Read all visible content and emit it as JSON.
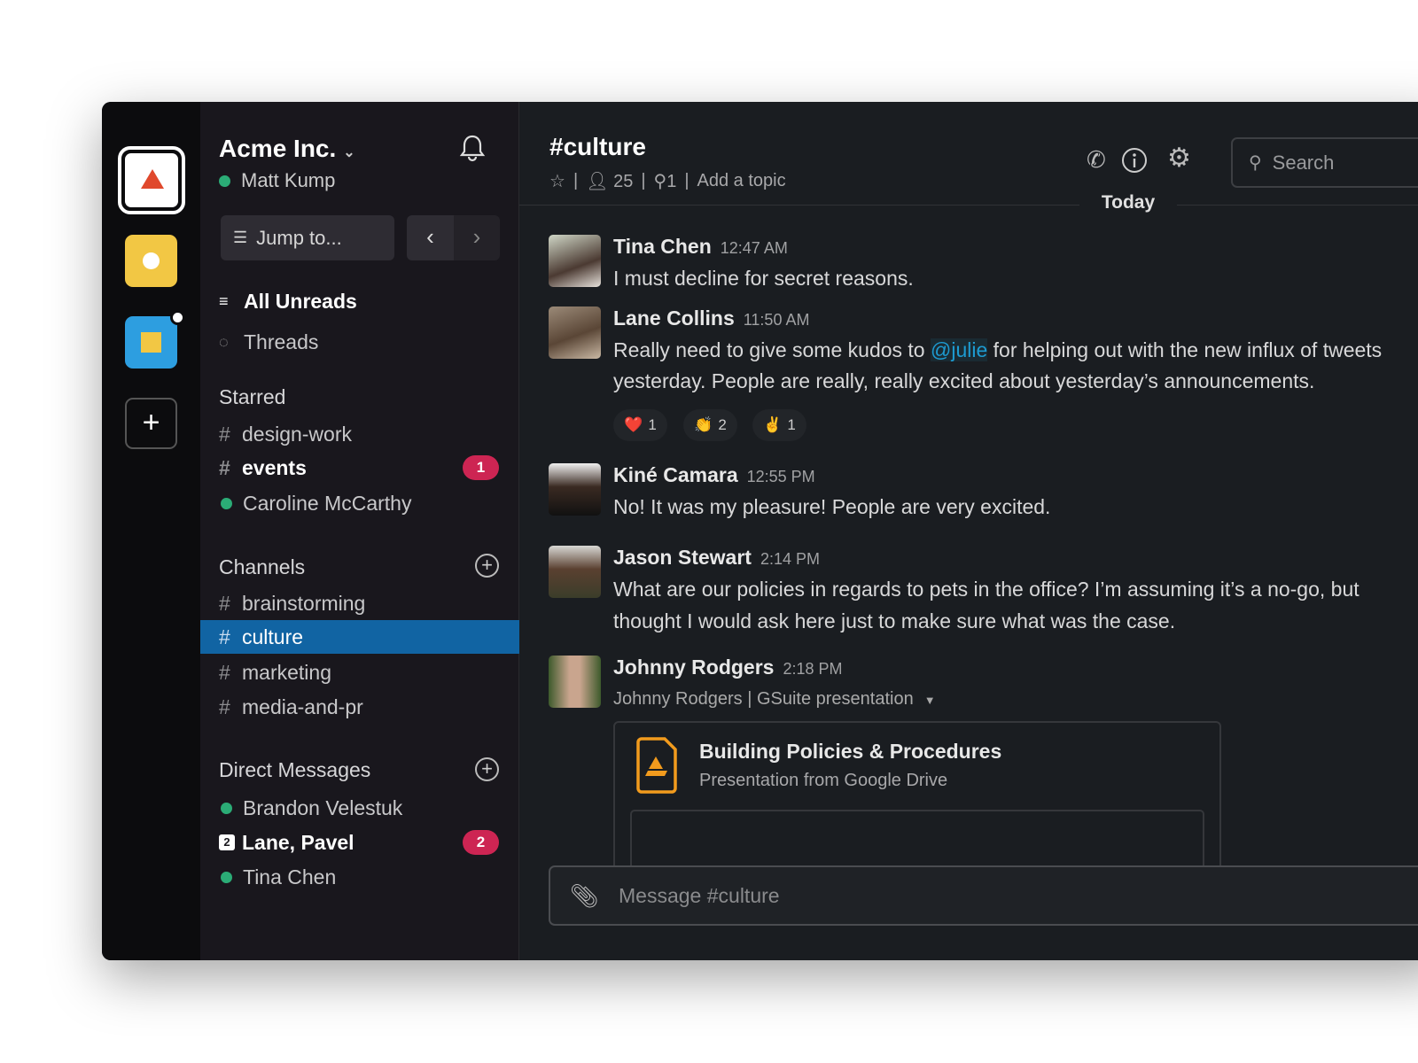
{
  "window": {
    "traffic_lights": [
      "#ed6a5e",
      "#f5bf4f",
      "#61c554"
    ]
  },
  "rail": {
    "workspaces": [
      {
        "color": "#ffffff",
        "accent": "#e0482c",
        "selected": true
      },
      {
        "color": "#f2c744",
        "accent": "#ffffff"
      },
      {
        "color": "#2d9ee0",
        "accent": "#f2c744",
        "unread_dot": true
      }
    ],
    "add_label": "+"
  },
  "sidebar": {
    "workspace_name": "Acme Inc.",
    "user": "Matt Kump",
    "jump_to": "Jump to...",
    "all_unreads": "All Unreads",
    "threads": "Threads",
    "starred_title": "Starred",
    "starred": [
      {
        "type": "channel",
        "label": "design-work"
      },
      {
        "type": "channel",
        "label": "events",
        "bold": true,
        "badge": "1"
      },
      {
        "type": "dm",
        "label": "Caroline McCarthy"
      }
    ],
    "channels_title": "Channels",
    "channels": [
      {
        "label": "brainstorming"
      },
      {
        "label": "culture",
        "selected": true
      },
      {
        "label": "marketing"
      },
      {
        "label": "media-and-pr"
      }
    ],
    "dms_title": "Direct Messages",
    "dms": [
      {
        "label": "Brandon Velestuk"
      },
      {
        "label": "Lane, Pavel",
        "bold": true,
        "badge": "2",
        "group_count": "2"
      },
      {
        "label": "Tina Chen"
      }
    ],
    "accent": "#1164a3",
    "badge_color": "#cd2553",
    "presence_color": "#2bac76"
  },
  "header": {
    "channel": "#culture",
    "members": "25",
    "pins": "1",
    "add_topic": "Add a topic",
    "search_placeholder": "Search",
    "divider": "|"
  },
  "day_divider": "Today",
  "messages": [
    {
      "name": "Tina Chen",
      "time": "12:47 AM",
      "lines": [
        "I must decline for secret reasons."
      ]
    },
    {
      "name": "Lane Collins",
      "time": "11:50 AM",
      "line1_pre": "Really need to give some kudos to ",
      "mention": "@julie",
      "line1_post": " for helping out with the new influx of tweets",
      "line2": "yesterday. People are really, really excited about yesterday’s announcements.",
      "reactions": [
        {
          "emoji": "❤️",
          "count": "1"
        },
        {
          "emoji": "👏",
          "count": "2"
        },
        {
          "emoji": "✌️",
          "count": "1"
        }
      ]
    },
    {
      "name": "Kiné Camara",
      "time": "12:55 PM",
      "lines": [
        "No! It was my pleasure! People are very excited."
      ]
    },
    {
      "name": "Jason Stewart",
      "time": "2:14 PM",
      "lines": [
        "What are our policies in regards to pets in the office? I’m assuming it’s a no-go, but",
        "thought I would ask here just to make sure what was the case."
      ]
    },
    {
      "name": "Johnny Rodgers",
      "time": "2:18 PM",
      "subtitle": "Johnny Rodgers | GSuite presentation",
      "attachment": {
        "title": "Building Policies & Procedures",
        "subtitle": "Presentation from Google Drive"
      }
    }
  ],
  "composer": {
    "placeholder": "Message #culture"
  }
}
